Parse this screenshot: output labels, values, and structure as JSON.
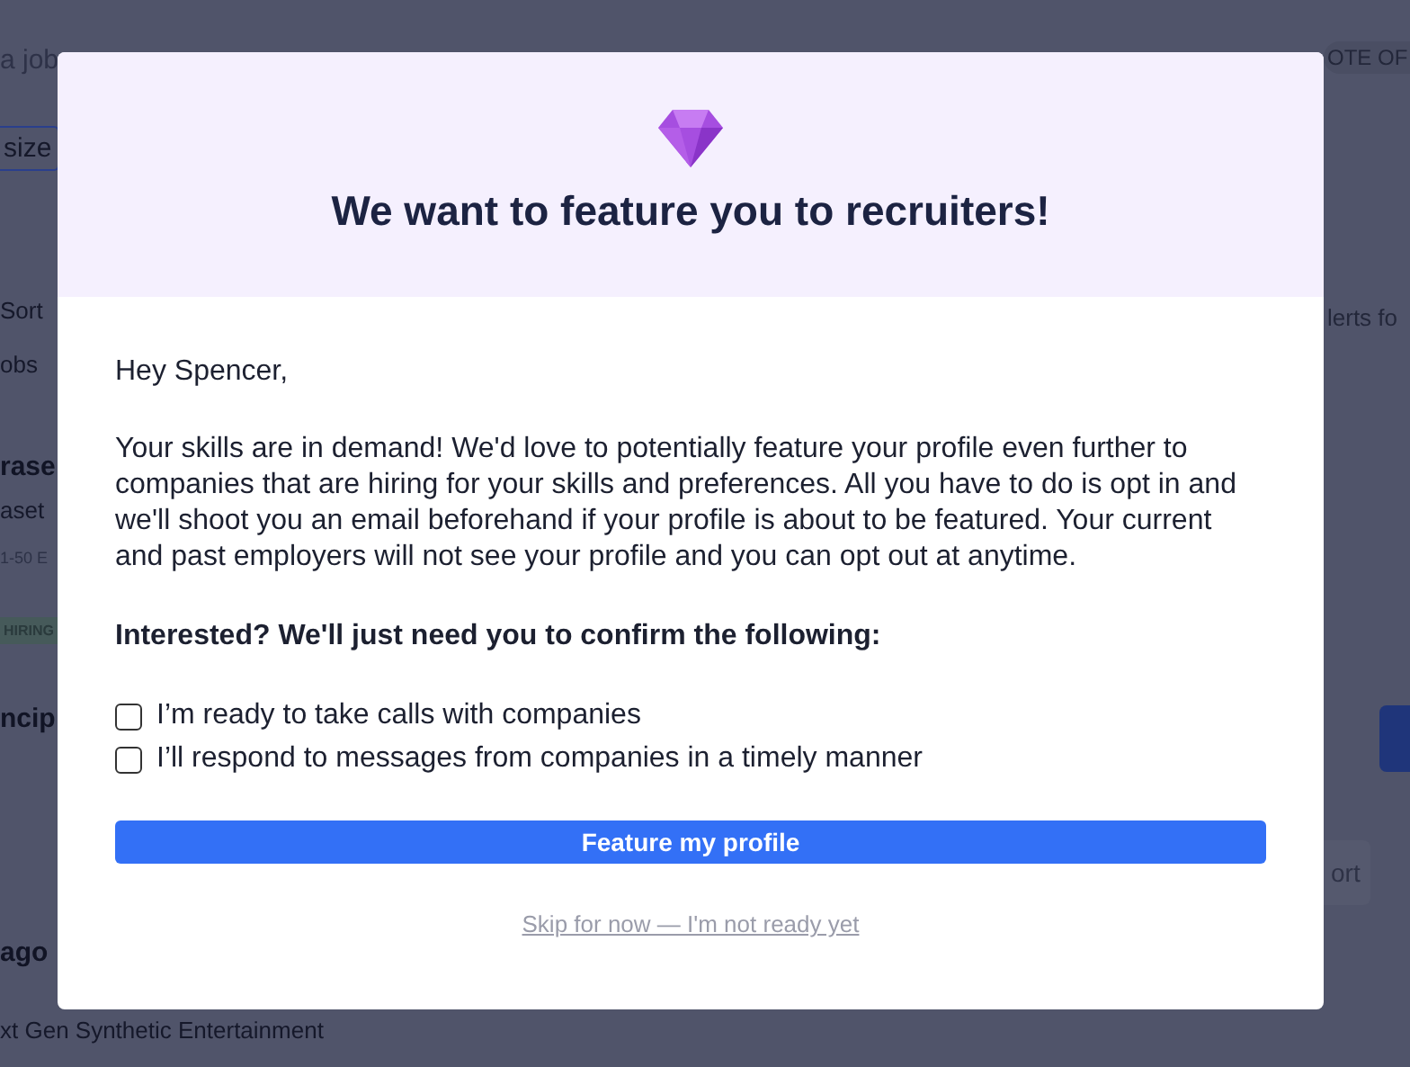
{
  "background": {
    "left": [
      {
        "kind": "field",
        "text": "a job"
      },
      {
        "kind": "focused-field",
        "text": "size"
      },
      {
        "kind": "text",
        "text": "Sort"
      },
      {
        "kind": "text",
        "text": "obs"
      },
      {
        "kind": "title",
        "text": "rase"
      },
      {
        "kind": "text",
        "text": "aset"
      },
      {
        "kind": "meta",
        "text": "1-50 E"
      },
      {
        "kind": "badge",
        "text": "HIRING"
      },
      {
        "kind": "title",
        "text": "ncip"
      },
      {
        "kind": "title",
        "text": "ago"
      }
    ],
    "right": [
      {
        "kind": "pill",
        "text": "OTE OF"
      },
      {
        "kind": "text",
        "text": "lerts fo"
      },
      {
        "kind": "soft-button",
        "text": "ort"
      }
    ],
    "bottom_text": "xt Gen Synthetic Entertainment"
  },
  "modal": {
    "title": "We want to feature you to recruiters!",
    "greeting": "Hey Spencer,",
    "message": "Your skills are in demand! We'd love to potentially feature your profile even further to companies that are hiring for your skills and preferences. All you have to do is opt in and we'll shoot you an email beforehand if your profile is about to be featured. Your current and past employers will not see your profile and you can opt out at anytime.",
    "prompt": "Interested? We'll just need you to confirm the following:",
    "confirmations": [
      {
        "label": "I’m ready to take calls with companies",
        "checked": false
      },
      {
        "label": "I’ll respond to messages from companies in a timely manner",
        "checked": false
      }
    ],
    "primary_button": "Feature my profile",
    "skip_link": "Skip for now — I'm not ready yet"
  }
}
